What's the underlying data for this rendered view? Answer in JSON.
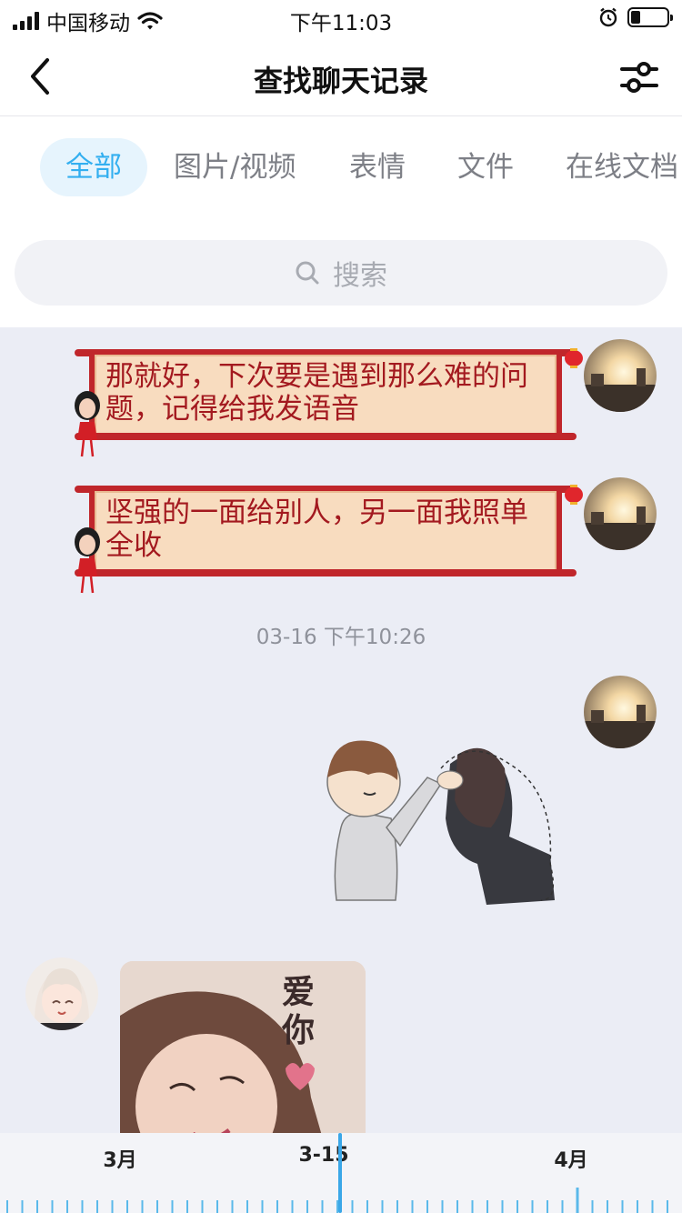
{
  "status_bar": {
    "carrier": "中国移动",
    "time": "下午11:03",
    "signal_bars": 4,
    "battery_level": 0.25
  },
  "nav": {
    "title": "查找聊天记录",
    "back_icon": "chevron-left-icon",
    "filter_icon": "sliders-icon"
  },
  "tabs": [
    {
      "label": "全部",
      "active": true
    },
    {
      "label": "图片/视频",
      "active": false
    },
    {
      "label": "表情",
      "active": false
    },
    {
      "label": "文件",
      "active": false
    },
    {
      "label": "在线文档",
      "active": false
    }
  ],
  "search": {
    "placeholder": "搜索",
    "icon": "search-icon"
  },
  "messages": [
    {
      "type": "text",
      "sender": "me",
      "text": "那就好，下次要是遇到那么难的问题，记得给我发语音"
    },
    {
      "type": "text",
      "sender": "me",
      "text": "坚强的一面给别人，另一面我照单全收"
    },
    {
      "type": "timestamp",
      "text": "03-16 下午10:26"
    },
    {
      "type": "sticker",
      "sender": "me",
      "description": "boy-patting-girl-head-sticker"
    },
    {
      "type": "image",
      "sender": "other",
      "caption_text": "爱你"
    }
  ],
  "timeline": {
    "labels": [
      "3月",
      "3-15",
      "4月"
    ]
  },
  "colors": {
    "accent": "#33aff0",
    "tab_active_bg": "#e6f4fd",
    "chat_bg": "#ebedf5",
    "bubble_paper": "#f8dcbf",
    "bubble_frame": "#c0262b",
    "bubble_text": "#a3191f",
    "timeline_cursor": "#3aa7e8"
  }
}
